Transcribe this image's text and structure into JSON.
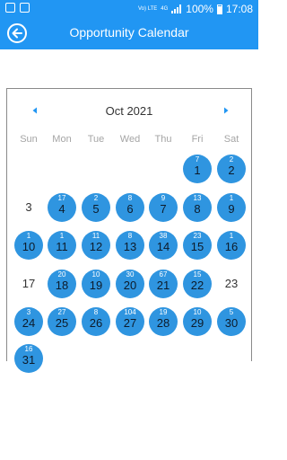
{
  "status": {
    "battery": "100%",
    "time": "17:08",
    "network": "4G",
    "volte": "Vo) LTE"
  },
  "header": {
    "title": "Opportunity Calendar"
  },
  "calendar": {
    "month_label": "Oct 2021",
    "weekdays": [
      "Sun",
      "Mon",
      "Tue",
      "Wed",
      "Thu",
      "Fri",
      "Sat"
    ],
    "days": [
      {
        "day": "1",
        "count": "7"
      },
      {
        "day": "2",
        "count": "2"
      },
      {
        "day": "3",
        "count": ""
      },
      {
        "day": "4",
        "count": "17"
      },
      {
        "day": "5",
        "count": "2"
      },
      {
        "day": "6",
        "count": "8"
      },
      {
        "day": "7",
        "count": "9"
      },
      {
        "day": "8",
        "count": "13"
      },
      {
        "day": "9",
        "count": "1"
      },
      {
        "day": "10",
        "count": "1"
      },
      {
        "day": "11",
        "count": "1"
      },
      {
        "day": "12",
        "count": "11"
      },
      {
        "day": "13",
        "count": "8"
      },
      {
        "day": "14",
        "count": "38"
      },
      {
        "day": "15",
        "count": "23"
      },
      {
        "day": "16",
        "count": "1"
      },
      {
        "day": "17",
        "count": ""
      },
      {
        "day": "18",
        "count": "20"
      },
      {
        "day": "19",
        "count": "10"
      },
      {
        "day": "20",
        "count": "30"
      },
      {
        "day": "21",
        "count": "67"
      },
      {
        "day": "22",
        "count": "15"
      },
      {
        "day": "23",
        "count": ""
      },
      {
        "day": "24",
        "count": "3"
      },
      {
        "day": "25",
        "count": "27"
      },
      {
        "day": "26",
        "count": "8"
      },
      {
        "day": "27",
        "count": "104"
      },
      {
        "day": "28",
        "count": "19"
      },
      {
        "day": "29",
        "count": "10"
      },
      {
        "day": "30",
        "count": "5"
      },
      {
        "day": "31",
        "count": "16"
      }
    ]
  },
  "colors": {
    "primary": "#2196f3",
    "event_circle": "#2f95e0"
  }
}
